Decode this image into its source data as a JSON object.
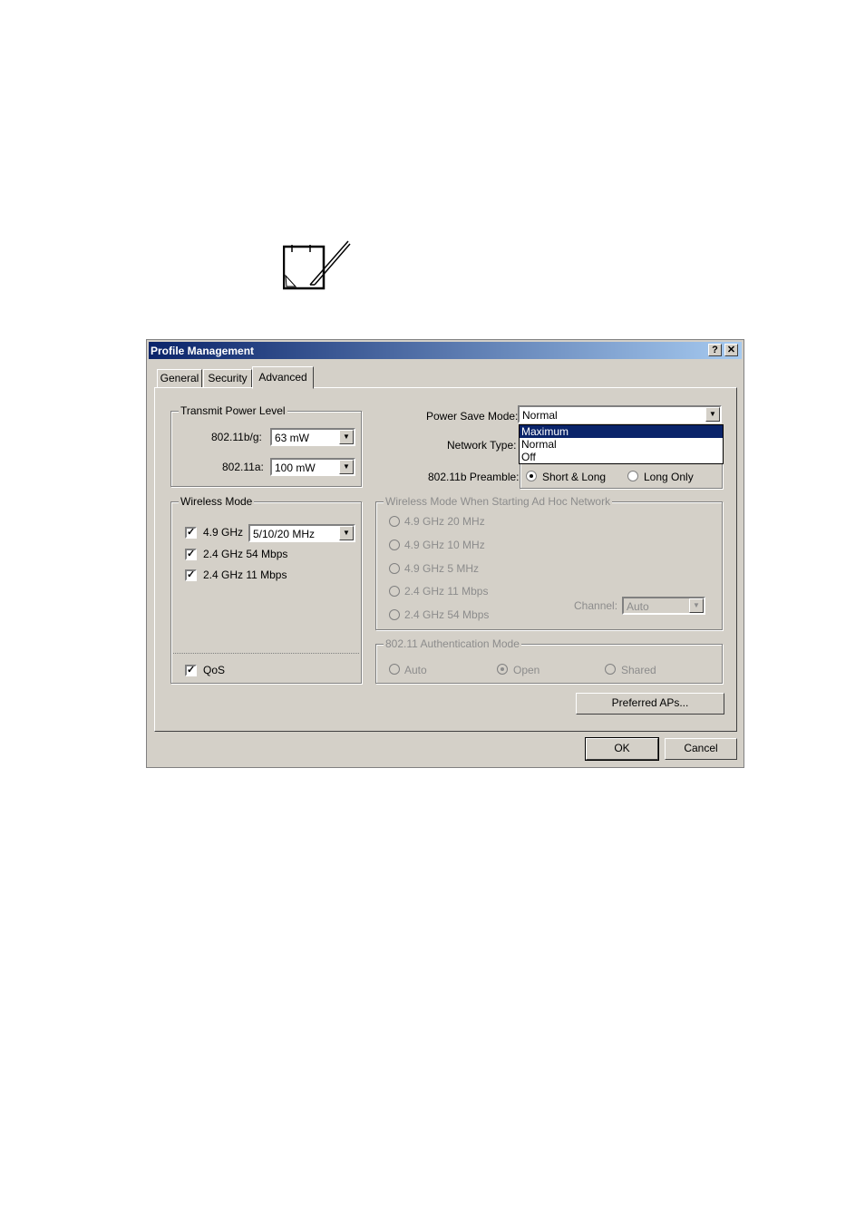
{
  "window": {
    "title": "Profile Management",
    "help_label": "?",
    "close_label": "✕"
  },
  "tabs": [
    {
      "label": "General"
    },
    {
      "label": "Security"
    },
    {
      "label": "Advanced",
      "active": true
    }
  ],
  "transmit_power": {
    "group_label": "Transmit Power Level",
    "bg_label": "802.11b/g:",
    "bg_value": "63 mW",
    "a_label": "802.11a:",
    "a_value": "100 mW"
  },
  "power_save": {
    "label": "Power Save Mode:",
    "value": "Normal",
    "options": [
      "Maximum",
      "Normal",
      "Off"
    ],
    "highlighted": "Maximum"
  },
  "network_type": {
    "label": "Network Type:"
  },
  "preamble": {
    "label": "802.11b Preamble:",
    "option_short_long": "Short & Long",
    "option_long_only": "Long Only",
    "selected": "Short & Long"
  },
  "wireless_mode": {
    "group_label": "Wireless Mode",
    "ghz49_label": "4.9 GHz",
    "ghz49_checked": true,
    "ghz49_bandwidth": "5/10/20 MHz",
    "ghz24_54_label": "2.4 GHz 54 Mbps",
    "ghz24_54_checked": true,
    "ghz24_11_label": "2.4 GHz 11 Mbps",
    "ghz24_11_checked": true,
    "qos_label": "QoS",
    "qos_checked": true
  },
  "adhoc_mode": {
    "group_label": "Wireless Mode When Starting Ad Hoc Network",
    "options": [
      "4.9 GHz 20 MHz",
      "4.9 GHz 10 MHz",
      "4.9 GHz 5 MHz",
      "2.4 GHz 11 Mbps",
      "2.4 GHz 54 Mbps"
    ],
    "channel_label": "Channel:",
    "channel_value": "Auto"
  },
  "auth_mode": {
    "group_label": "802.11 Authentication Mode",
    "auto_label": "Auto",
    "open_label": "Open",
    "shared_label": "Shared",
    "selected": "Open"
  },
  "buttons": {
    "preferred_aps": "Preferred APs...",
    "ok": "OK",
    "cancel": "Cancel"
  },
  "icons": {
    "note": "note-pencil-icon",
    "check": "check-icon",
    "dropdown": "dropdown-arrow-icon"
  }
}
